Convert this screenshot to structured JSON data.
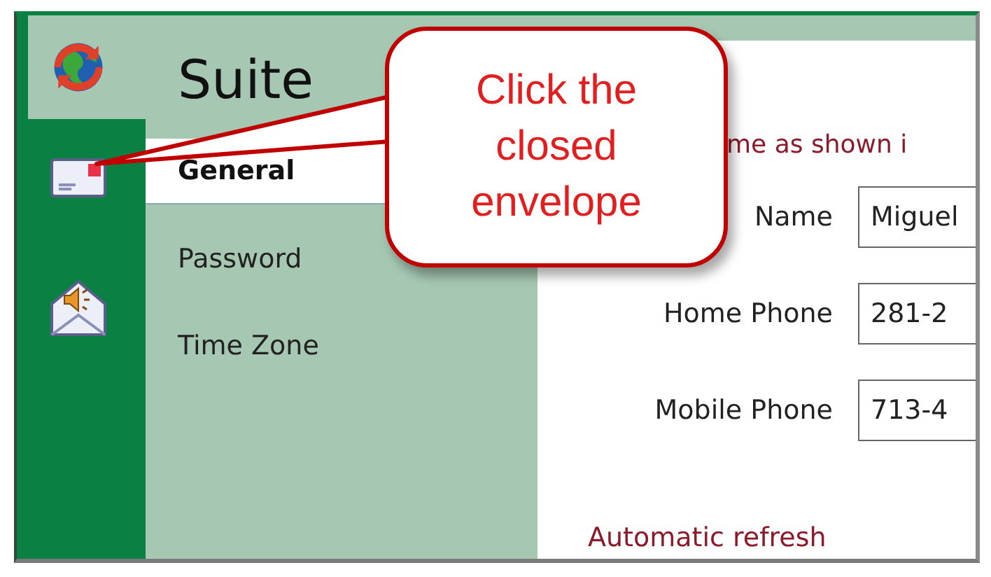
{
  "app": {
    "title": "Suite"
  },
  "rail": [
    {
      "kind": "closed-envelope"
    },
    {
      "kind": "open-envelope"
    }
  ],
  "nav": [
    {
      "label": "General",
      "selected": true
    },
    {
      "label": "Password",
      "selected": false
    },
    {
      "label": "Time Zone",
      "selected": false
    }
  ],
  "content": {
    "intro": "me as shown i",
    "fields": [
      {
        "label": "Name",
        "value": "Miguel"
      },
      {
        "label": "Home Phone",
        "value": "281-2"
      },
      {
        "label": "Mobile Phone",
        "value": "713-4"
      }
    ],
    "section": "Automatic refresh"
  },
  "callout": {
    "text": "Click the closed envelope"
  }
}
